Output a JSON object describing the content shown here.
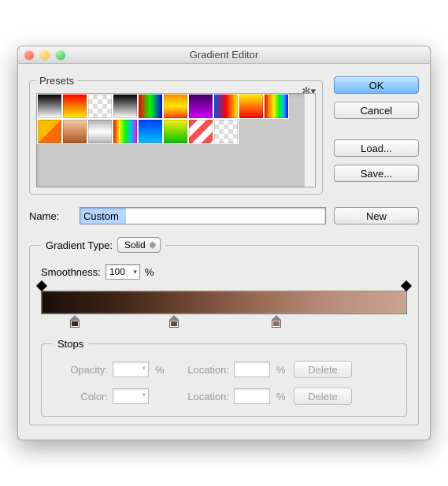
{
  "window": {
    "title": "Gradient Editor"
  },
  "presets": {
    "legend": "Presets"
  },
  "buttons": {
    "ok": "OK",
    "cancel": "Cancel",
    "load": "Load...",
    "save": "Save...",
    "new": "New"
  },
  "name": {
    "label": "Name:",
    "value": "Custom"
  },
  "gradientType": {
    "label": "Gradient Type:",
    "value": "Solid"
  },
  "smoothness": {
    "label": "Smoothness:",
    "value": "100",
    "unit": "%"
  },
  "stops": {
    "legend": "Stops",
    "opacity_label": "Opacity:",
    "opacity_value": "",
    "opacity_unit": "%",
    "opacity_loc_label": "Location:",
    "opacity_loc_value": "",
    "opacity_loc_unit": "%",
    "color_label": "Color:",
    "color_loc_label": "Location:",
    "color_loc_value": "",
    "color_loc_unit": "%",
    "delete": "Delete"
  },
  "gradient": {
    "colors": [
      "#1a0e08",
      "#3b2315",
      "#6e4533",
      "#9b6b55",
      "#b98f7c",
      "#c9a392"
    ],
    "opacity_stops_pct": [
      0,
      100
    ],
    "color_stops_pct": [
      10,
      36,
      64
    ]
  },
  "preset_swatches": [
    "linear-gradient(#000,#fff)",
    "linear-gradient(#ff0000,#fff000)",
    "repeating-conic-gradient(#ddd 0 25%, #fff 0 50%) 0 0/12px 12px",
    "linear-gradient(#000,#fff)",
    "linear-gradient(90deg,#ff0000,#00ff00,#0000ff)",
    "linear-gradient(#ff8c00,#ffe600,#ff3c00)",
    "linear-gradient(#3b0060,#d400ff)",
    "linear-gradient(90deg,#0050ff,#ff0000,#ffef00)",
    "linear-gradient(#ffef00,#ff0000)",
    "linear-gradient(90deg,#ff0000,#ff8c00,#ffef00,#00ff00,#00bfff,#4000ff)",
    "linear-gradient(135deg,#ffba00 0 50%,#ff6a00 50% 100%)",
    "linear-gradient(#f7c9a0,#b0531f)",
    "linear-gradient(#b0b0b0,#ffffff,#b0b0b0)",
    "linear-gradient(90deg,#ff0000,#ffef00,#00ff00,#00bfff,#ff00ff)",
    "linear-gradient(#003dff,#00c2ff)",
    "linear-gradient(#ffef00,#00c200)",
    "repeating-linear-gradient(135deg,#ff4d4d 0 8px,#fff 8px 16px)",
    "repeating-conic-gradient(#ddd 0 25%, #fff 0 50%) 0 0/12px 12px"
  ]
}
